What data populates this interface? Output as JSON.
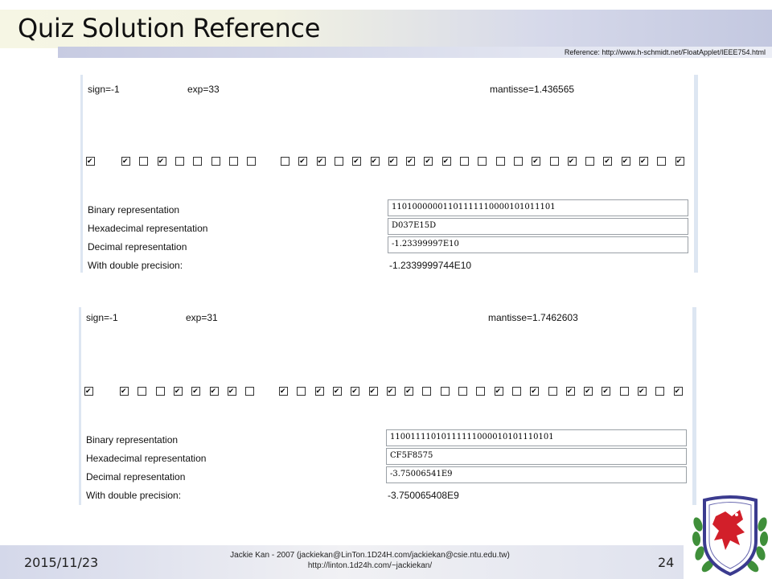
{
  "title": "Quiz Solution Reference",
  "reference": "Reference: http://www.h-schmidt.net/FloatApplet/IEEE754.html",
  "panels": [
    {
      "sign": "sign=-1",
      "exp": "exp=33",
      "mantissa": "mantisse=1.436565",
      "bits": "11010000001101111110000101011101",
      "rows": {
        "binary_label": "Binary representation",
        "binary_value": "11010000001101111110000101011101",
        "hex_label": "Hexadecimal representation",
        "hex_value": "D037E15D",
        "decimal_label": "Decimal representation",
        "decimal_value": "-1.23399997E10",
        "double_label": "With double precision:",
        "double_value": "-1.2339999744E10"
      }
    },
    {
      "sign": "sign=-1",
      "exp": "exp=31",
      "mantissa": "mantisse=1.7462603",
      "bits": "11001111010111111000010101110101",
      "rows": {
        "binary_label": "Binary representation",
        "binary_value": "11001111010111111000010101110101",
        "hex_label": "Hexadecimal representation",
        "hex_value": "CF5F8575",
        "decimal_label": "Decimal representation",
        "decimal_value": "-3.75006541E9",
        "double_label": "With double precision:",
        "double_value": "-3.750065408E9"
      }
    }
  ],
  "footer": {
    "date": "2015/11/23",
    "credit_line1": "Jackie Kan - 2007 (jackiekan@LinTon.1D24H.com/jackiekan@csie.ntu.edu.tw)",
    "credit_line2": "http://linton.1d24h.com/~jackiekan/",
    "page": "24"
  },
  "icons": {
    "crest": "dragon-crest-icon",
    "checkbox": "checkbox-icon"
  },
  "colors": {
    "title_band_start": "#f6f6e4",
    "title_band_end": "#c3c8e0",
    "panel_edge": "#dde6f2"
  }
}
